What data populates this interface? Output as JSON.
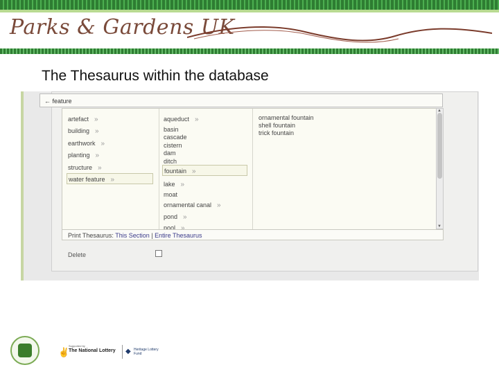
{
  "header": {
    "logo_text": "Parks & Gardens UK"
  },
  "slide": {
    "title": "The Thesaurus within the database"
  },
  "thesaurus": {
    "path_arrow": "←",
    "path_label": "feature",
    "column1": [
      {
        "label": "artefact",
        "selected": false
      },
      {
        "label": "building",
        "selected": false
      },
      {
        "label": "earthwork",
        "selected": false
      },
      {
        "label": "planting",
        "selected": false
      },
      {
        "label": "structure",
        "selected": false
      },
      {
        "label": "water feature",
        "selected": true
      }
    ],
    "column2": [
      {
        "label": "aqueduct",
        "has_children": true
      },
      {
        "label": "basin",
        "has_children": false
      },
      {
        "label": "cascade",
        "has_children": false
      },
      {
        "label": "cistern",
        "has_children": false
      },
      {
        "label": "dam",
        "has_children": false
      },
      {
        "label": "ditch",
        "has_children": false
      },
      {
        "label": "fountain",
        "has_children": true,
        "selected": true
      },
      {
        "label": "lake",
        "has_children": true
      },
      {
        "label": "moat",
        "has_children": false
      },
      {
        "label": "ornamental canal",
        "has_children": true
      },
      {
        "label": "pond",
        "has_children": true
      },
      {
        "label": "pool",
        "has_children": true
      }
    ],
    "column3": [
      {
        "label": "ornamental fountain"
      },
      {
        "label": "shell fountain"
      },
      {
        "label": "trick fountain"
      }
    ],
    "arrow_glyph": "»",
    "print_label": "Print Thesaurus:",
    "print_section": "This Section",
    "print_sep": "|",
    "print_entire": "Entire Thesaurus",
    "delete_label": "Delete",
    "delete_checked": false
  },
  "footer": {
    "lottery_supported": "Supported by",
    "lottery_name": "The National Lottery",
    "hlf_name": "Heritage Lottery Fund"
  },
  "colors": {
    "banner_green": "#2e7d32",
    "logo_brown": "#7a4a3a",
    "panel_bg": "#fbfbf3"
  }
}
